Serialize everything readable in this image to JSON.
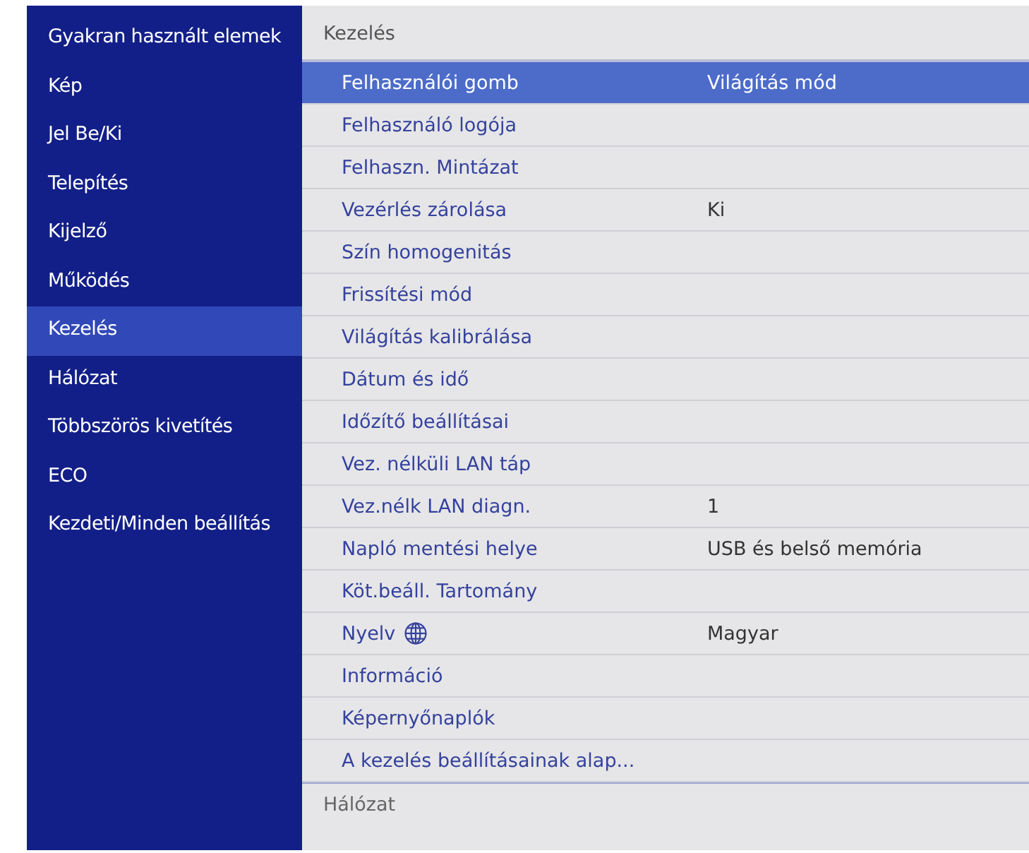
{
  "sidebar": {
    "items": [
      {
        "label": "Gyakran használt elemek",
        "selected": false
      },
      {
        "label": "Kép",
        "selected": false
      },
      {
        "label": "Jel Be/Ki",
        "selected": false
      },
      {
        "label": "Telepítés",
        "selected": false
      },
      {
        "label": "Kijelző",
        "selected": false
      },
      {
        "label": "Működés",
        "selected": false
      },
      {
        "label": "Kezelés",
        "selected": true
      },
      {
        "label": "Hálózat",
        "selected": false
      },
      {
        "label": "Többszörös kivetítés",
        "selected": false
      },
      {
        "label": "ECO",
        "selected": false
      },
      {
        "label": "Kezdeti/Minden beállítás",
        "selected": false
      }
    ]
  },
  "panel": {
    "title": "Kezelés",
    "rows": [
      {
        "label": "Felhasználói gomb",
        "value": "Világítás mód",
        "selected": true
      },
      {
        "label": "Felhasználó logója",
        "selected": false
      },
      {
        "label": "Felhaszn. Mintázat",
        "selected": false
      },
      {
        "label": "Vezérlés zárolása",
        "value": "Ki",
        "selected": false
      },
      {
        "label": "Szín homogenitás",
        "selected": false
      },
      {
        "label": "Frissítési mód",
        "selected": false
      },
      {
        "label": "Világítás kalibrálása",
        "selected": false
      },
      {
        "label": "Dátum és idő",
        "selected": false
      },
      {
        "label": "Időzítő beállításai",
        "selected": false
      },
      {
        "label": "Vez. nélküli LAN táp",
        "selected": false
      },
      {
        "label": "Vez.nélk LAN diagn.",
        "value": "1",
        "selected": false
      },
      {
        "label": "Napló mentési helye",
        "value": "USB és belső memória",
        "selected": false
      },
      {
        "label": "Köt.beáll. Tartomány",
        "selected": false
      },
      {
        "label": "Nyelv",
        "kind": "language",
        "value": "Magyar",
        "selected": false
      },
      {
        "label": "Információ",
        "selected": false
      },
      {
        "label": "Képernyőnaplók",
        "selected": false
      },
      {
        "label": "A kezelés beállításainak alap...",
        "selected": false
      }
    ],
    "next_section": "Hálózat"
  }
}
